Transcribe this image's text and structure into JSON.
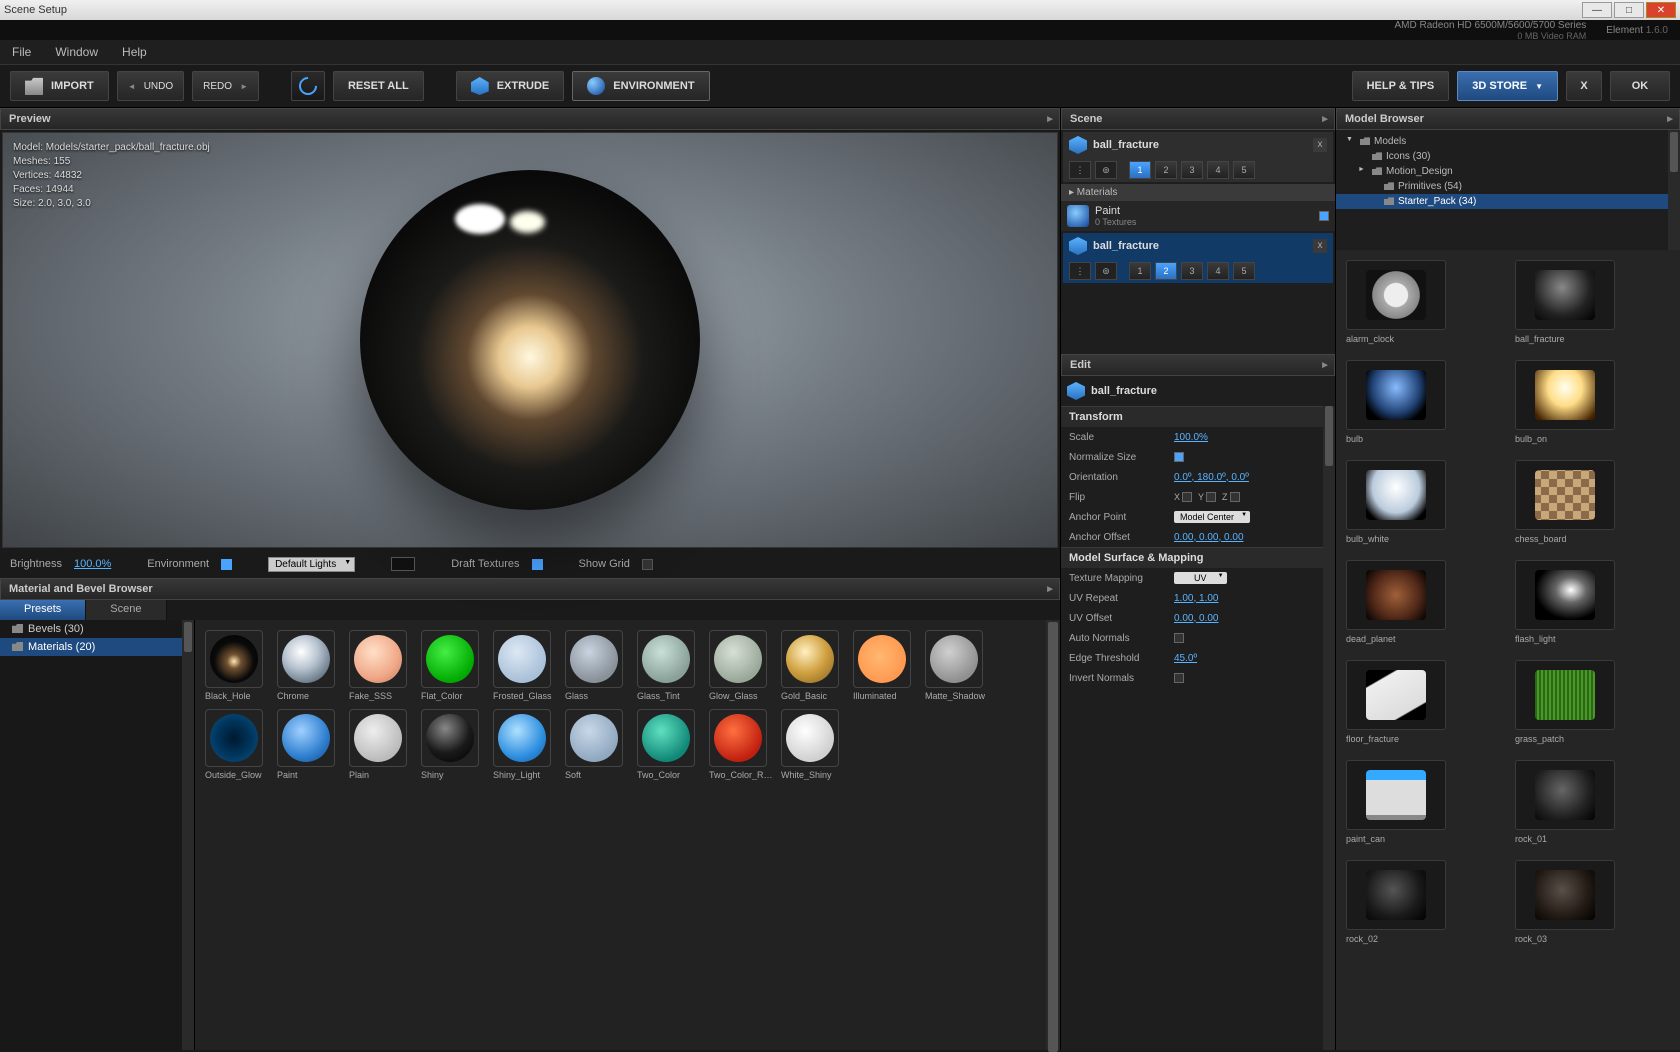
{
  "titlebar": {
    "title": "Scene Setup"
  },
  "headerinfo": {
    "gpu": "AMD Radeon HD 6500M/5600/5700 Series",
    "vram": "0 MB Video RAM",
    "app": "Element",
    "ver": "1.6.0"
  },
  "menubar": {
    "file": "File",
    "window": "Window",
    "help": "Help"
  },
  "toolbar": {
    "import": "IMPORT",
    "undo": "UNDO",
    "redo": "REDO",
    "resetall": "RESET ALL",
    "extrude": "EXTRUDE",
    "environment": "ENVIRONMENT",
    "helptips": "HELP & TIPS",
    "store": "3D STORE",
    "x": "X",
    "ok": "OK"
  },
  "preview": {
    "title": "Preview",
    "info": {
      "model": "Model: Models/starter_pack/ball_fracture.obj",
      "meshes": "Meshes: 155",
      "vertices": "Vertices: 44832",
      "faces": "Faces: 14944",
      "size": "Size: 2.0, 3.0, 3.0"
    },
    "ctrl": {
      "brightness_label": "Brightness",
      "brightness_val": "100.0%",
      "env_label": "Environment",
      "lights_label": "Default Lights",
      "draft_label": "Draft Textures",
      "grid_label": "Show Grid"
    }
  },
  "matbrowser": {
    "title": "Material and Bevel Browser",
    "tabs": {
      "presets": "Presets",
      "scene": "Scene"
    },
    "tree": {
      "bevels": "Bevels (30)",
      "materials": "Materials (20)"
    },
    "items": [
      {
        "name": "Black_Hole",
        "bg": "radial-gradient(circle at 50% 55%,#ffe8b0 0%,#705030 20%,#0a0a0a 55%,#000 100%)"
      },
      {
        "name": "Chrome",
        "bg": "radial-gradient(circle at 40% 35%,#fff,#b8c4d0 40%,#607080 80%)"
      },
      {
        "name": "Fake_SSS",
        "bg": "radial-gradient(circle at 40% 35%,#ffe0c8,#f0a888 60%,#c07858 100%)"
      },
      {
        "name": "Flat_Color",
        "bg": "radial-gradient(circle at 40% 35%,#4e4,#0a0 70%)"
      },
      {
        "name": "Frosted_Glass",
        "bg": "radial-gradient(circle at 40% 35%,#dde8f4,#a8c0d8 70%)"
      },
      {
        "name": "Glass",
        "bg": "radial-gradient(circle at 40% 35%,#c8d4e0,#889098 70%)"
      },
      {
        "name": "Glass_Tint",
        "bg": "radial-gradient(circle at 40% 35%,#c8e0d8,#88a098 70%)"
      },
      {
        "name": "Glow_Glass",
        "bg": "radial-gradient(circle at 40% 35%,#d8e0d8,#98a898 70%)"
      },
      {
        "name": "Gold_Basic",
        "bg": "radial-gradient(circle at 40% 35%,#fff0c0,#d0a040 50%,#806020 100%)"
      },
      {
        "name": "Illuminated",
        "bg": "radial-gradient(circle at 45% 45%,#ffb870,#ff9850 70%)"
      },
      {
        "name": "Matte_Shadow",
        "bg": "radial-gradient(circle at 40% 35%,#d0d0d0,#909090 70%)"
      },
      {
        "name": "Outside_Glow",
        "bg": "radial-gradient(circle at 50% 50%,#001830,#003860 55%,#0a4878 80%),radial-gradient(#4af,transparent)"
      },
      {
        "name": "Paint",
        "bg": "radial-gradient(circle at 40% 35%,#a0d0ff,#3080d0 60%,#104888 100%)"
      },
      {
        "name": "Plain",
        "bg": "radial-gradient(circle at 40% 35%,#eee,#bbb 70%)"
      },
      {
        "name": "Shiny",
        "bg": "radial-gradient(circle at 40% 30%,#888,#1a1a1a 55%,#000 100%)"
      },
      {
        "name": "Shiny_Light",
        "bg": "radial-gradient(circle at 40% 35%,#b0e0ff,#3090e0 60%,#1058a0 100%)"
      },
      {
        "name": "Soft",
        "bg": "radial-gradient(circle at 40% 35%,#c8d8e8,#90a8c0 70%)"
      },
      {
        "name": "Two_Color",
        "bg": "radial-gradient(circle at 40% 35%,#60e0c0,#108878 70%)"
      },
      {
        "name": "Two_Color_Reflect",
        "bg": "radial-gradient(circle at 40% 35%,#ff7040,#c02010 70%)"
      },
      {
        "name": "White_Shiny",
        "bg": "radial-gradient(circle at 40% 35%,#fff,#d0d0d0 70%)"
      }
    ]
  },
  "scene": {
    "title": "Scene",
    "items": [
      {
        "name": "ball_fracture",
        "active_group": 1,
        "selected": false
      },
      {
        "name": "ball_fracture",
        "active_group": 2,
        "selected": true
      }
    ],
    "materials_label": "Materials",
    "material": {
      "name": "Paint",
      "sub": "0 Textures"
    },
    "groups": [
      "1",
      "2",
      "3",
      "4",
      "5"
    ]
  },
  "edit": {
    "title": "Edit",
    "obj": "ball_fracture",
    "transform": {
      "header": "Transform",
      "scale_l": "Scale",
      "scale_v": "100.0%",
      "norm_l": "Normalize Size",
      "orient_l": "Orientation",
      "orient_v": "0.0º, 180.0º, 0.0º",
      "flip_l": "Flip",
      "flip_x": "X",
      "flip_y": "Y",
      "flip_z": "Z",
      "anchor_l": "Anchor Point",
      "anchor_v": "Model Center",
      "aoff_l": "Anchor Offset",
      "aoff_v": "0.00, 0.00, 0.00"
    },
    "surface": {
      "header": "Model Surface & Mapping",
      "tex_l": "Texture Mapping",
      "tex_v": "UV",
      "uvr_l": "UV Repeat",
      "uvr_v": "1.00, 1.00",
      "uvo_l": "UV Offset",
      "uvo_v": "0.00, 0.00",
      "autonorm_l": "Auto Normals",
      "edge_l": "Edge Threshold",
      "edge_v": "45.0º",
      "invnorm_l": "Invert Normals"
    }
  },
  "modelbrowser": {
    "title": "Model Browser",
    "tree": {
      "models": "Models",
      "icons": "Icons (30)",
      "motion": "Motion_Design",
      "primitives": "Primitives (54)",
      "starter": "Starter_Pack (34)"
    },
    "items": [
      {
        "name": "alarm_clock"
      },
      {
        "name": "ball_fracture"
      },
      {
        "name": "bulb"
      },
      {
        "name": "bulb_on"
      },
      {
        "name": "bulb_white"
      },
      {
        "name": "chess_board"
      },
      {
        "name": "dead_planet"
      },
      {
        "name": "flash_light"
      },
      {
        "name": "floor_fracture"
      },
      {
        "name": "grass_patch"
      },
      {
        "name": "paint_can"
      },
      {
        "name": "rock_01"
      },
      {
        "name": "rock_02"
      },
      {
        "name": "rock_03"
      }
    ]
  }
}
